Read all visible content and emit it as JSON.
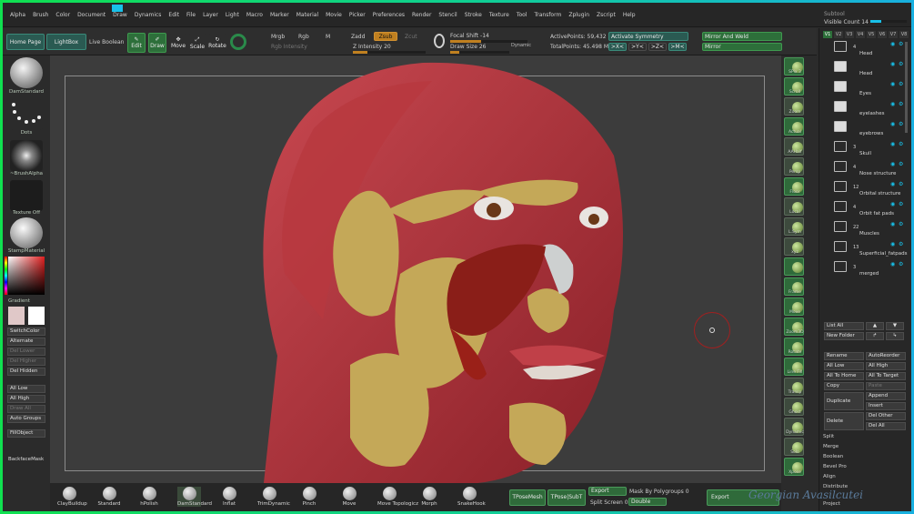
{
  "colors": {
    "accent_green": "#2f6a3a",
    "accent_teal": "#18c0e8",
    "frame_green": "#10e050",
    "frame_blue": "#18b0e0",
    "muscle_red": "#b03038",
    "fat_yellow": "#c4a858"
  },
  "menu": [
    "Alpha",
    "Brush",
    "Color",
    "Document",
    "Draw",
    "Dynamics",
    "Edit",
    "File",
    "Layer",
    "Light",
    "Macro",
    "Marker",
    "Material",
    "Movie",
    "Picker",
    "Preferences",
    "Render",
    "Stencil",
    "Stroke",
    "Texture",
    "Tool",
    "Transform",
    "Zplugin",
    "Zscript",
    "Help"
  ],
  "subtool_header": {
    "title": "Subtool",
    "visible_count_label": "Visible Count",
    "visible_count": "14"
  },
  "toolbar": {
    "home_page": "Home Page",
    "lightbox": "LightBox",
    "live_boolean": "Live Boolean",
    "edit": "Edit",
    "draw": "Draw",
    "move": "Move",
    "scale": "Scale",
    "rotate": "Rotate",
    "mrgb": "Mrgb",
    "rgb": "Rgb",
    "m": "M",
    "rgb_intensity": "Rgb Intensity",
    "zadd": "Zadd",
    "zsub": "Zsub",
    "zcut": "Zcut",
    "z_intensity_label": "Z Intensity",
    "z_intensity": "20",
    "focal_shift_label": "Focal Shift",
    "focal_shift": "-14",
    "draw_size_label": "Draw Size",
    "draw_size": "26",
    "dynamic": "Dynamic",
    "active_points_label": "ActivePoints:",
    "active_points": "59,432",
    "total_points_label": "TotalPoints:",
    "total_points": "45.498 Mil",
    "activate_symmetry": "Activate Symmetry",
    "sym_x": ">X<",
    "sym_y": ">Y<",
    "sym_z": ">Z<",
    "sym_m": ">M<",
    "mirror_and_weld": "Mirror And Weld",
    "mirror": "Mirror"
  },
  "left": {
    "brush": "DamStandard",
    "stroke": "Dots",
    "alpha": "~BrushAlpha",
    "texture": "Texture Off",
    "material": "StampMaterial",
    "gradient": "Gradient",
    "switch_color": "SwitchColor",
    "alternate": "Alternate",
    "del_lower": "Del Lower",
    "del_higher": "Del Higher",
    "del_hidden": "Del Hidden",
    "all_low": "All Low",
    "all_high": "All High",
    "draw_all": "Draw All",
    "auto_groups": "Auto Groups",
    "fill_object": "FillObject",
    "backface_mask": "BackfaceMask"
  },
  "rshelf": [
    "SPix 3",
    "Scroll",
    "Zoom",
    "Actual",
    "AAHalf",
    "Persp",
    "Floor",
    "Local",
    "L.Sym",
    "xyz",
    "",
    "Frame",
    "Move",
    "Zoom3D",
    "Rotate",
    "Line Fill",
    "Transp",
    "Ghost",
    "Dynamic",
    "Solo",
    "Xpose"
  ],
  "subtools": {
    "tabs": [
      "V1",
      "V2",
      "V3",
      "V4",
      "V5",
      "V6",
      "V7",
      "V8"
    ],
    "items": [
      {
        "count": "4",
        "name": "Head"
      },
      {
        "count": "",
        "name": "Head"
      },
      {
        "count": "",
        "name": "Eyes"
      },
      {
        "count": "",
        "name": "eyelashes"
      },
      {
        "count": "",
        "name": "eyebrows"
      },
      {
        "count": "3",
        "name": "Skull"
      },
      {
        "count": "4",
        "name": "Nose structure"
      },
      {
        "count": "12",
        "name": "Orbital structure"
      },
      {
        "count": "4",
        "name": "Orbit fat pads"
      },
      {
        "count": "22",
        "name": "Muscles"
      },
      {
        "count": "13",
        "name": "Superficial_fatpads"
      },
      {
        "count": "3",
        "name": "merged"
      }
    ],
    "list_all": "List All",
    "new_folder": "New Folder",
    "rename": "Rename",
    "auto_reorder": "AutoReorder",
    "all_low": "All Low",
    "all_high": "All High",
    "all_to_home": "All To Home",
    "all_to_target": "All To Target",
    "copy": "Copy",
    "paste": "Paste",
    "duplicate": "Duplicate",
    "append": "Append",
    "insert": "Insert",
    "delete": "Delete",
    "del_other": "Del Other",
    "del_all": "Del All",
    "split": "Split",
    "merge": "Merge",
    "boolean": "Boolean",
    "bevel_pro": "Bevel Pro",
    "align": "Align",
    "distribute": "Distribute",
    "project": "Project"
  },
  "brushes": [
    "ClayBuildup",
    "Standard",
    "hPolish",
    "DamStandard",
    "Inflat",
    "TrimDynamic",
    "Pinch",
    "Move",
    "Move Topologicz",
    "Morph",
    "SnakeHook"
  ],
  "bottom": {
    "tpose_mesh": "TPoseMesh",
    "tpose_subt": "TPose|SubT",
    "export": "Export",
    "split_screen": "Split Screen",
    "split_screen_val": "0",
    "mask_by_polygroups": "Mask By Polygroups",
    "mask_val": "0",
    "double": "Double",
    "export2": "Export"
  },
  "watermark": "Georgian Avasilcutei"
}
